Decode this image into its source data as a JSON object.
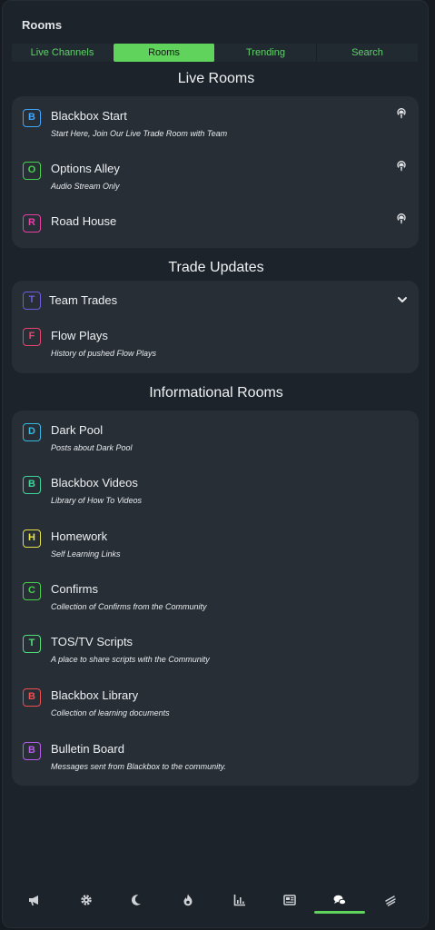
{
  "header": {
    "title": "Rooms"
  },
  "tabs": [
    {
      "label": "Live Channels",
      "active": false
    },
    {
      "label": "Rooms",
      "active": true
    },
    {
      "label": "Trending",
      "active": false
    },
    {
      "label": "Search",
      "active": false
    }
  ],
  "sections": {
    "live": {
      "title": "Live Rooms",
      "items": [
        {
          "letter": "B",
          "color": "#3ea6ff",
          "title": "Blackbox Start",
          "subtitle": "Start Here, Join Our Live Trade Room with Team",
          "icon": "podcast-icon"
        },
        {
          "letter": "O",
          "color": "#47d14d",
          "title": "Options Alley",
          "subtitle": "Audio Stream Only",
          "icon": "podcast-icon"
        },
        {
          "letter": "R",
          "color": "#e83fa4",
          "title": "Road House",
          "subtitle": "",
          "icon": "podcast-icon"
        }
      ]
    },
    "trade": {
      "title": "Trade Updates",
      "items": [
        {
          "letter": "T",
          "color": "#6f5bdc",
          "title": "Team Trades",
          "subtitle": "",
          "icon": "chevron-down-icon"
        },
        {
          "letter": "F",
          "color": "#e8446e",
          "title": "Flow Plays",
          "subtitle": "History of pushed Flow Plays"
        }
      ]
    },
    "info": {
      "title": "Informational Rooms",
      "items": [
        {
          "letter": "D",
          "color": "#35b9e0",
          "title": "Dark Pool",
          "subtitle": "Posts about Dark Pool"
        },
        {
          "letter": "B",
          "color": "#3fd49a",
          "title": "Blackbox Videos",
          "subtitle": "Library of How To Videos"
        },
        {
          "letter": "H",
          "color": "#e6e24a",
          "title": "Homework",
          "subtitle": "Self Learning Links"
        },
        {
          "letter": "C",
          "color": "#47d14d",
          "title": "Confirms",
          "subtitle": "Collection of Confirms from the Community"
        },
        {
          "letter": "T",
          "color": "#4fe07a",
          "title": "TOS/TV Scripts",
          "subtitle": "A place to share scripts with the Community"
        },
        {
          "letter": "B",
          "color": "#ee4f4f",
          "title": "Blackbox Library",
          "subtitle": "Collection of learning documents"
        },
        {
          "letter": "B",
          "color": "#b75ce6",
          "title": "Bulletin Board",
          "subtitle": "Messages sent from Blackbox to the community."
        }
      ]
    }
  },
  "bottom_nav": [
    {
      "icon": "megaphone-icon",
      "active": false
    },
    {
      "icon": "gear-icon",
      "active": false
    },
    {
      "icon": "moon-icon",
      "active": false
    },
    {
      "icon": "fire-icon",
      "active": false
    },
    {
      "icon": "chart-icon",
      "active": false
    },
    {
      "icon": "newspaper-icon",
      "active": false
    },
    {
      "icon": "chat-icon",
      "active": true
    },
    {
      "icon": "swipe-icon",
      "active": false
    }
  ]
}
